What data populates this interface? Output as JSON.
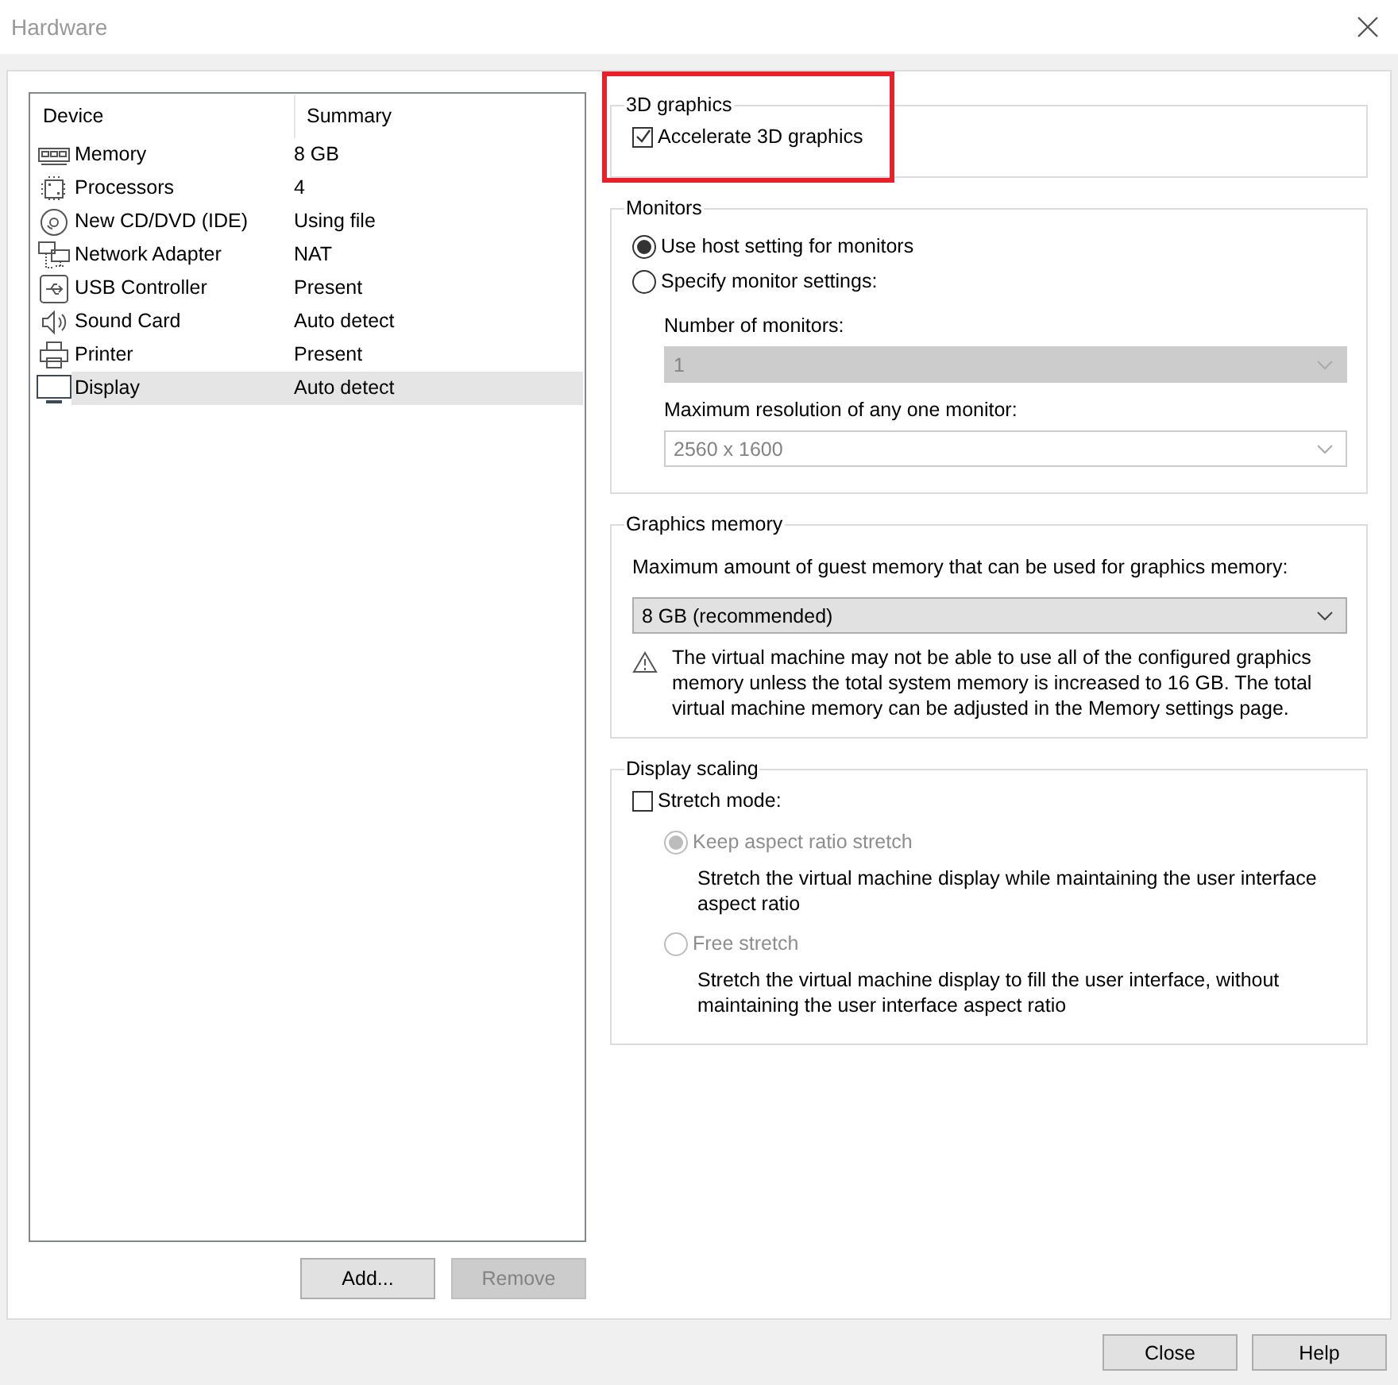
{
  "window": {
    "title": "Hardware"
  },
  "device_table": {
    "columns": [
      "Device",
      "Summary"
    ],
    "rows": [
      {
        "kind": "memory",
        "device": "Memory",
        "summary": "8 GB",
        "selected": false
      },
      {
        "kind": "processor",
        "device": "Processors",
        "summary": "4",
        "selected": false
      },
      {
        "kind": "disc",
        "device": "New CD/DVD (IDE)",
        "summary": "Using file",
        "selected": false
      },
      {
        "kind": "network",
        "device": "Network Adapter",
        "summary": "NAT",
        "selected": false
      },
      {
        "kind": "usb",
        "device": "USB Controller",
        "summary": "Present",
        "selected": false
      },
      {
        "kind": "sound",
        "device": "Sound Card",
        "summary": "Auto detect",
        "selected": false
      },
      {
        "kind": "printer",
        "device": "Printer",
        "summary": "Present",
        "selected": false
      },
      {
        "kind": "display",
        "device": "Display",
        "summary": "Auto detect",
        "selected": true
      }
    ]
  },
  "list_buttons": [
    {
      "label": "Add...",
      "disabled": false
    },
    {
      "label": "Remove",
      "disabled": true
    }
  ],
  "graphics_3d": {
    "title": "3D graphics",
    "highlighted": true,
    "checkbox": {
      "label": "Accelerate 3D graphics",
      "checked": true
    }
  },
  "monitors": {
    "title": "Monitors",
    "options": [
      {
        "label": "Use host setting for monitors",
        "selected": true
      },
      {
        "label": "Specify monitor settings:",
        "selected": false
      }
    ],
    "fields": [
      {
        "label": "Number of monitors:",
        "value": "1",
        "kind": "dropdown",
        "disabled": true
      },
      {
        "label": "Maximum resolution of any one monitor:",
        "value": "2560 x 1600",
        "kind": "editable",
        "disabled": true
      }
    ]
  },
  "graphics_memory": {
    "title": "Graphics memory",
    "label": "Maximum amount of guest memory that can be used for graphics memory:",
    "value": "8 GB (recommended)",
    "warning": "The virtual machine may not be able to use all of the configured graphics memory unless the total system memory is increased to 16 GB. The total virtual machine memory can be adjusted in the Memory settings page."
  },
  "display_scaling": {
    "title": "Display scaling",
    "checkbox": {
      "label": "Stretch mode:",
      "checked": false
    },
    "options": [
      {
        "label": "Keep aspect ratio stretch",
        "selected": true,
        "disabled": true,
        "description": "Stretch the virtual machine display while maintaining the user interface aspect ratio"
      },
      {
        "label": "Free stretch",
        "selected": false,
        "disabled": true,
        "description": "Stretch the virtual machine display to fill the user interface, without maintaining the user interface aspect ratio"
      }
    ]
  },
  "footer_buttons": [
    {
      "label": "Close"
    },
    {
      "label": "Help"
    }
  ]
}
